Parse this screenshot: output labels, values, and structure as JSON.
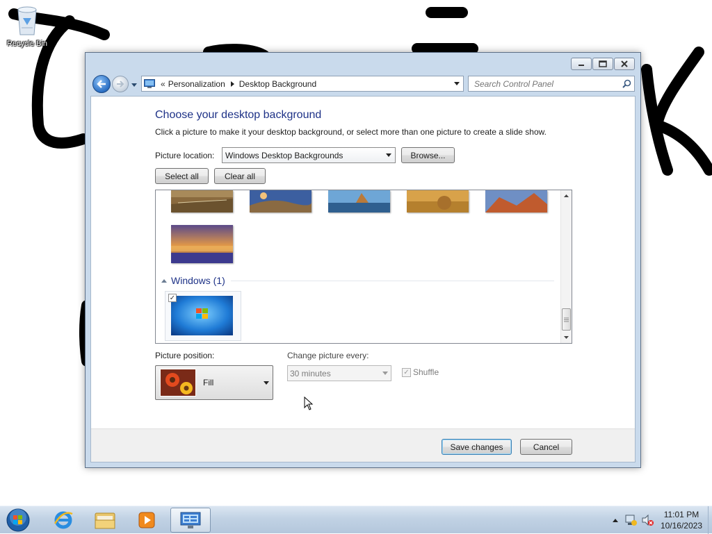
{
  "desktop": {
    "recycle_bin_label": "Recycle Bin"
  },
  "window": {
    "navigation": {
      "breadcrumb": [
        "Personalization",
        "Desktop Background"
      ],
      "search_placeholder": "Search Control Panel"
    },
    "heading": "Choose your desktop background",
    "subtext": "Click a picture to make it your desktop background, or select more than one picture to create a slide show.",
    "picture_location": {
      "label": "Picture location:",
      "value": "Windows Desktop Backgrounds",
      "browse_label": "Browse..."
    },
    "select_all_label": "Select all",
    "clear_all_label": "Clear all",
    "gallery": {
      "windows_group_title": "Windows (1)",
      "windows_item_checked": true
    },
    "picture_position": {
      "label": "Picture position:",
      "value": "Fill"
    },
    "change_picture": {
      "label": "Change picture every:",
      "value": "30 minutes",
      "enabled": false
    },
    "shuffle": {
      "label": "Shuffle",
      "checked": true,
      "enabled": false
    },
    "save_label": "Save changes",
    "cancel_label": "Cancel"
  },
  "taskbar": {
    "clock_time": "11:01 PM",
    "clock_date": "10/16/2023"
  },
  "colors": {
    "heading": "#1e3287",
    "window_frame": "#c9daec",
    "taskbar": "#c1d2e4"
  }
}
